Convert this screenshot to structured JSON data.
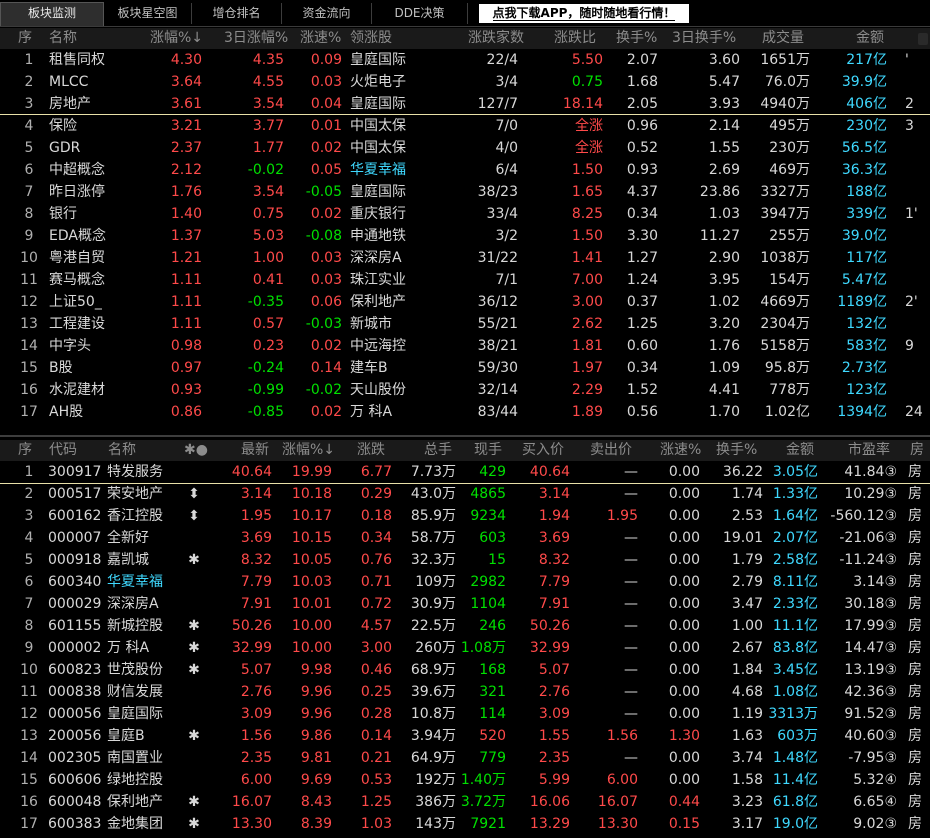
{
  "tabs": [
    {
      "label": "板块监测",
      "active": true
    },
    {
      "label": "板块星空图",
      "active": false
    },
    {
      "label": "增仓排名",
      "active": false
    },
    {
      "label": "资金流向",
      "active": false
    },
    {
      "label": "DDE决策",
      "active": false
    }
  ],
  "promo": "点我下载APP，随时随地看行情！",
  "upper": {
    "headers": [
      "序",
      "名称",
      "涨幅%↓",
      "3日涨幅%",
      "涨速%",
      "领涨股",
      "涨跌家数",
      "涨跌比",
      "换手%",
      "3日换手%",
      "成交量",
      "金额"
    ],
    "rows": [
      {
        "i": "1",
        "name": "租售同权",
        "chg": "4.30",
        "chg3": "4.35",
        "spd": "0.09",
        "lead": "皇庭国际",
        "cnt": "22/4",
        "ratio": "5.50",
        "turn": "2.07",
        "turn3": "3.60",
        "vol": "1651万",
        "amt": "217亿",
        "extra": "'"
      },
      {
        "i": "2",
        "name": "MLCC",
        "chg": "3.64",
        "chg3": "4.55",
        "spd": "0.03",
        "lead": "火炬电子",
        "cnt": "3/4",
        "ratio": "0.75",
        "turn": "1.68",
        "turn3": "5.47",
        "vol": "76.0万",
        "amt": "39.9亿",
        "extra": ""
      },
      {
        "i": "3",
        "name": "房地产",
        "chg": "3.61",
        "chg3": "3.54",
        "spd": "0.04",
        "lead": "皇庭国际",
        "cnt": "127/7",
        "ratio": "18.14",
        "turn": "2.05",
        "turn3": "3.93",
        "vol": "4940万",
        "amt": "406亿",
        "extra": "2"
      },
      {
        "i": "4",
        "name": "保险",
        "chg": "3.21",
        "chg3": "3.77",
        "spd": "0.01",
        "lead": "中国太保",
        "cnt": "7/0",
        "ratio": "全涨",
        "turn": "0.96",
        "turn3": "2.14",
        "vol": "495万",
        "amt": "230亿",
        "extra": "3"
      },
      {
        "i": "5",
        "name": "GDR",
        "chg": "2.37",
        "chg3": "1.77",
        "spd": "0.02",
        "lead": "中国太保",
        "cnt": "4/0",
        "ratio": "全涨",
        "turn": "0.52",
        "turn3": "1.55",
        "vol": "230万",
        "amt": "56.5亿",
        "extra": ""
      },
      {
        "i": "6",
        "name": "中超概念",
        "chg": "2.12",
        "chg3": "-0.02",
        "spd": "0.05",
        "lead": "华夏幸福",
        "cnt": "6/4",
        "ratio": "1.50",
        "turn": "0.93",
        "turn3": "2.69",
        "vol": "469万",
        "amt": "36.3亿",
        "extra": ""
      },
      {
        "i": "7",
        "name": "昨日涨停",
        "chg": "1.76",
        "chg3": "3.54",
        "spd": "-0.05",
        "lead": "皇庭国际",
        "cnt": "38/23",
        "ratio": "1.65",
        "turn": "4.37",
        "turn3": "23.86",
        "vol": "3327万",
        "amt": "188亿",
        "extra": ""
      },
      {
        "i": "8",
        "name": "银行",
        "chg": "1.40",
        "chg3": "0.75",
        "spd": "0.02",
        "lead": "重庆银行",
        "cnt": "33/4",
        "ratio": "8.25",
        "turn": "0.34",
        "turn3": "1.03",
        "vol": "3947万",
        "amt": "339亿",
        "extra": "1'"
      },
      {
        "i": "9",
        "name": "EDA概念",
        "chg": "1.37",
        "chg3": "5.03",
        "spd": "-0.08",
        "lead": "申通地铁",
        "cnt": "3/2",
        "ratio": "1.50",
        "turn": "3.30",
        "turn3": "11.27",
        "vol": "255万",
        "amt": "39.0亿",
        "extra": ""
      },
      {
        "i": "10",
        "name": "粤港自贸",
        "chg": "1.21",
        "chg3": "1.00",
        "spd": "0.03",
        "lead": "深深房A",
        "cnt": "31/22",
        "ratio": "1.41",
        "turn": "1.27",
        "turn3": "2.90",
        "vol": "1038万",
        "amt": "117亿",
        "extra": ""
      },
      {
        "i": "11",
        "name": "赛马概念",
        "chg": "1.11",
        "chg3": "0.41",
        "spd": "0.03",
        "lead": "珠江实业",
        "cnt": "7/1",
        "ratio": "7.00",
        "turn": "1.24",
        "turn3": "3.95",
        "vol": "154万",
        "amt": "5.47亿",
        "extra": ""
      },
      {
        "i": "12",
        "name": "上证50_",
        "chg": "1.11",
        "chg3": "-0.35",
        "spd": "0.06",
        "lead": "保利地产",
        "cnt": "36/12",
        "ratio": "3.00",
        "turn": "0.37",
        "turn3": "1.02",
        "vol": "4669万",
        "amt": "1189亿",
        "extra": "2'"
      },
      {
        "i": "13",
        "name": "工程建设",
        "chg": "1.11",
        "chg3": "0.57",
        "spd": "-0.03",
        "lead": "新城市",
        "cnt": "55/21",
        "ratio": "2.62",
        "turn": "1.25",
        "turn3": "3.20",
        "vol": "2304万",
        "amt": "132亿",
        "extra": ""
      },
      {
        "i": "14",
        "name": "中字头",
        "chg": "0.98",
        "chg3": "0.23",
        "spd": "0.02",
        "lead": "中远海控",
        "cnt": "38/21",
        "ratio": "1.81",
        "turn": "0.60",
        "turn3": "1.76",
        "vol": "5158万",
        "amt": "583亿",
        "extra": "9"
      },
      {
        "i": "15",
        "name": "B股",
        "chg": "0.97",
        "chg3": "-0.24",
        "spd": "0.14",
        "lead": "建车B",
        "cnt": "59/30",
        "ratio": "1.97",
        "turn": "0.34",
        "turn3": "1.09",
        "vol": "95.8万",
        "amt": "2.73亿",
        "extra": ""
      },
      {
        "i": "16",
        "name": "水泥建材",
        "chg": "0.93",
        "chg3": "-0.99",
        "spd": "-0.02",
        "lead": "天山股份",
        "cnt": "32/14",
        "ratio": "2.29",
        "turn": "1.52",
        "turn3": "4.41",
        "vol": "778万",
        "amt": "123亿",
        "extra": ""
      },
      {
        "i": "17",
        "name": "AH股",
        "chg": "0.86",
        "chg3": "-0.85",
        "spd": "0.02",
        "lead": "万  科A",
        "cnt": "83/44",
        "ratio": "1.89",
        "turn": "0.56",
        "turn3": "1.70",
        "vol": "1.02亿",
        "amt": "1394亿",
        "extra": "24"
      }
    ]
  },
  "lower": {
    "headers": [
      "序",
      "代码",
      "名称",
      "✱●",
      "最新",
      "涨幅%↓",
      "涨跌",
      "总手",
      "现手",
      "买入价",
      "卖出价",
      "涨速%",
      "换手%",
      "金额",
      "市盈率",
      "房"
    ],
    "rows": [
      {
        "i": "1",
        "code": "300917",
        "name": "特发服务",
        "mk": "",
        "last": "40.64",
        "chg": "19.99",
        "diff": "6.77",
        "vol": "7.73万",
        "cur": "429",
        "bid": "40.64",
        "ask": "—",
        "spd": "0.00",
        "turn": "36.22",
        "amt": "3.05亿",
        "pe": "41.84③",
        "ex": "房",
        "namecls": "wht",
        "curcls": "grn"
      },
      {
        "i": "2",
        "code": "000517",
        "name": "荣安地产",
        "mk": "⬍",
        "last": "3.14",
        "chg": "10.18",
        "diff": "0.29",
        "vol": "43.0万",
        "cur": "4865",
        "bid": "3.14",
        "ask": "—",
        "spd": "0.00",
        "turn": "1.74",
        "amt": "1.33亿",
        "pe": "10.29③",
        "ex": "房",
        "namecls": "wht",
        "curcls": "grn"
      },
      {
        "i": "3",
        "code": "600162",
        "name": "香江控股",
        "mk": "⬍",
        "last": "1.95",
        "chg": "10.17",
        "diff": "0.18",
        "vol": "85.9万",
        "cur": "9234",
        "bid": "1.94",
        "ask": "1.95",
        "spd": "0.00",
        "turn": "2.53",
        "amt": "1.64亿",
        "pe": "-560.12③",
        "ex": "房",
        "namecls": "wht",
        "curcls": "grn"
      },
      {
        "i": "4",
        "code": "000007",
        "name": "全新好",
        "mk": "",
        "last": "3.69",
        "chg": "10.15",
        "diff": "0.34",
        "vol": "58.7万",
        "cur": "603",
        "bid": "3.69",
        "ask": "—",
        "spd": "0.00",
        "turn": "19.01",
        "amt": "2.07亿",
        "pe": "-21.06③",
        "ex": "房",
        "namecls": "wht",
        "curcls": "grn"
      },
      {
        "i": "5",
        "code": "000918",
        "name": "嘉凯城",
        "mk": "✱",
        "last": "8.32",
        "chg": "10.05",
        "diff": "0.76",
        "vol": "32.3万",
        "cur": "15",
        "bid": "8.32",
        "ask": "—",
        "spd": "0.00",
        "turn": "1.79",
        "amt": "2.58亿",
        "pe": "-11.24③",
        "ex": "房",
        "namecls": "wht",
        "curcls": "grn"
      },
      {
        "i": "6",
        "code": "600340",
        "name": "华夏幸福",
        "mk": "",
        "last": "7.79",
        "chg": "10.03",
        "diff": "0.71",
        "vol": "109万",
        "cur": "2982",
        "bid": "7.79",
        "ask": "—",
        "spd": "0.00",
        "turn": "2.79",
        "amt": "8.11亿",
        "pe": "3.14③",
        "ex": "房",
        "namecls": "cyan",
        "curcls": "grn"
      },
      {
        "i": "7",
        "code": "000029",
        "name": "深深房A",
        "mk": "",
        "last": "7.91",
        "chg": "10.01",
        "diff": "0.72",
        "vol": "30.9万",
        "cur": "1104",
        "bid": "7.91",
        "ask": "—",
        "spd": "0.00",
        "turn": "3.47",
        "amt": "2.33亿",
        "pe": "30.18③",
        "ex": "房",
        "namecls": "wht",
        "curcls": "grn"
      },
      {
        "i": "8",
        "code": "601155",
        "name": "新城控股",
        "mk": "✱",
        "last": "50.26",
        "chg": "10.00",
        "diff": "4.57",
        "vol": "22.5万",
        "cur": "246",
        "bid": "50.26",
        "ask": "—",
        "spd": "0.00",
        "turn": "1.00",
        "amt": "11.1亿",
        "pe": "17.99③",
        "ex": "房",
        "namecls": "wht",
        "curcls": "grn"
      },
      {
        "i": "9",
        "code": "000002",
        "name": "万  科A",
        "mk": "✱",
        "last": "32.99",
        "chg": "10.00",
        "diff": "3.00",
        "vol": "260万",
        "cur": "1.08万",
        "bid": "32.99",
        "ask": "—",
        "spd": "0.00",
        "turn": "2.67",
        "amt": "83.8亿",
        "pe": "14.47③",
        "ex": "房",
        "namecls": "wht",
        "curcls": "grn"
      },
      {
        "i": "10",
        "code": "600823",
        "name": "世茂股份",
        "mk": "✱",
        "last": "5.07",
        "chg": "9.98",
        "diff": "0.46",
        "vol": "68.9万",
        "cur": "168",
        "bid": "5.07",
        "ask": "—",
        "spd": "0.00",
        "turn": "1.84",
        "amt": "3.45亿",
        "pe": "13.19③",
        "ex": "房",
        "namecls": "wht",
        "curcls": "grn"
      },
      {
        "i": "11",
        "code": "000838",
        "name": "财信发展",
        "mk": "",
        "last": "2.76",
        "chg": "9.96",
        "diff": "0.25",
        "vol": "39.6万",
        "cur": "321",
        "bid": "2.76",
        "ask": "—",
        "spd": "0.00",
        "turn": "4.68",
        "amt": "1.08亿",
        "pe": "42.36③",
        "ex": "房",
        "namecls": "wht",
        "curcls": "grn"
      },
      {
        "i": "12",
        "code": "000056",
        "name": "皇庭国际",
        "mk": "",
        "last": "3.09",
        "chg": "9.96",
        "diff": "0.28",
        "vol": "10.8万",
        "cur": "114",
        "bid": "3.09",
        "ask": "—",
        "spd": "0.00",
        "turn": "1.19",
        "amt": "3313万",
        "pe": "91.52③",
        "ex": "房",
        "namecls": "wht",
        "curcls": "grn"
      },
      {
        "i": "13",
        "code": "200056",
        "name": "皇庭B",
        "mk": "✱",
        "last": "1.56",
        "chg": "9.86",
        "diff": "0.14",
        "vol": "3.94万",
        "cur": "520",
        "bid": "1.55",
        "ask": "1.56",
        "spd": "1.30",
        "turn": "1.63",
        "amt": "603万",
        "pe": "40.60③",
        "ex": "房",
        "namecls": "wht",
        "curcls": "red"
      },
      {
        "i": "14",
        "code": "002305",
        "name": "南国置业",
        "mk": "",
        "last": "2.35",
        "chg": "9.81",
        "diff": "0.21",
        "vol": "64.9万",
        "cur": "779",
        "bid": "2.35",
        "ask": "—",
        "spd": "0.00",
        "turn": "3.74",
        "amt": "1.48亿",
        "pe": "-7.95③",
        "ex": "房",
        "namecls": "wht",
        "curcls": "grn"
      },
      {
        "i": "15",
        "code": "600606",
        "name": "绿地控股",
        "mk": "",
        "last": "6.00",
        "chg": "9.69",
        "diff": "0.53",
        "vol": "192万",
        "cur": "1.40万",
        "bid": "5.99",
        "ask": "6.00",
        "spd": "0.00",
        "turn": "1.58",
        "amt": "11.4亿",
        "pe": "5.32④",
        "ex": "房",
        "namecls": "wht",
        "curcls": "grn"
      },
      {
        "i": "16",
        "code": "600048",
        "name": "保利地产",
        "mk": "✱",
        "last": "16.07",
        "chg": "8.43",
        "diff": "1.25",
        "vol": "386万",
        "cur": "3.72万",
        "bid": "16.06",
        "ask": "16.07",
        "spd": "0.44",
        "turn": "3.23",
        "amt": "61.8亿",
        "pe": "6.65④",
        "ex": "房",
        "namecls": "wht",
        "curcls": "grn"
      },
      {
        "i": "17",
        "code": "600383",
        "name": "金地集团",
        "mk": "✱",
        "last": "13.30",
        "chg": "8.39",
        "diff": "1.03",
        "vol": "143万",
        "cur": "7921",
        "bid": "13.29",
        "ask": "13.30",
        "spd": "0.15",
        "turn": "3.17",
        "amt": "19.0亿",
        "pe": "9.02③",
        "ex": "房",
        "namecls": "wht",
        "curcls": "grn"
      }
    ]
  },
  "colors": {
    "up": "#ff4a4a",
    "down": "#00e000",
    "amount": "#3fd9ff",
    "background": "#000000"
  }
}
